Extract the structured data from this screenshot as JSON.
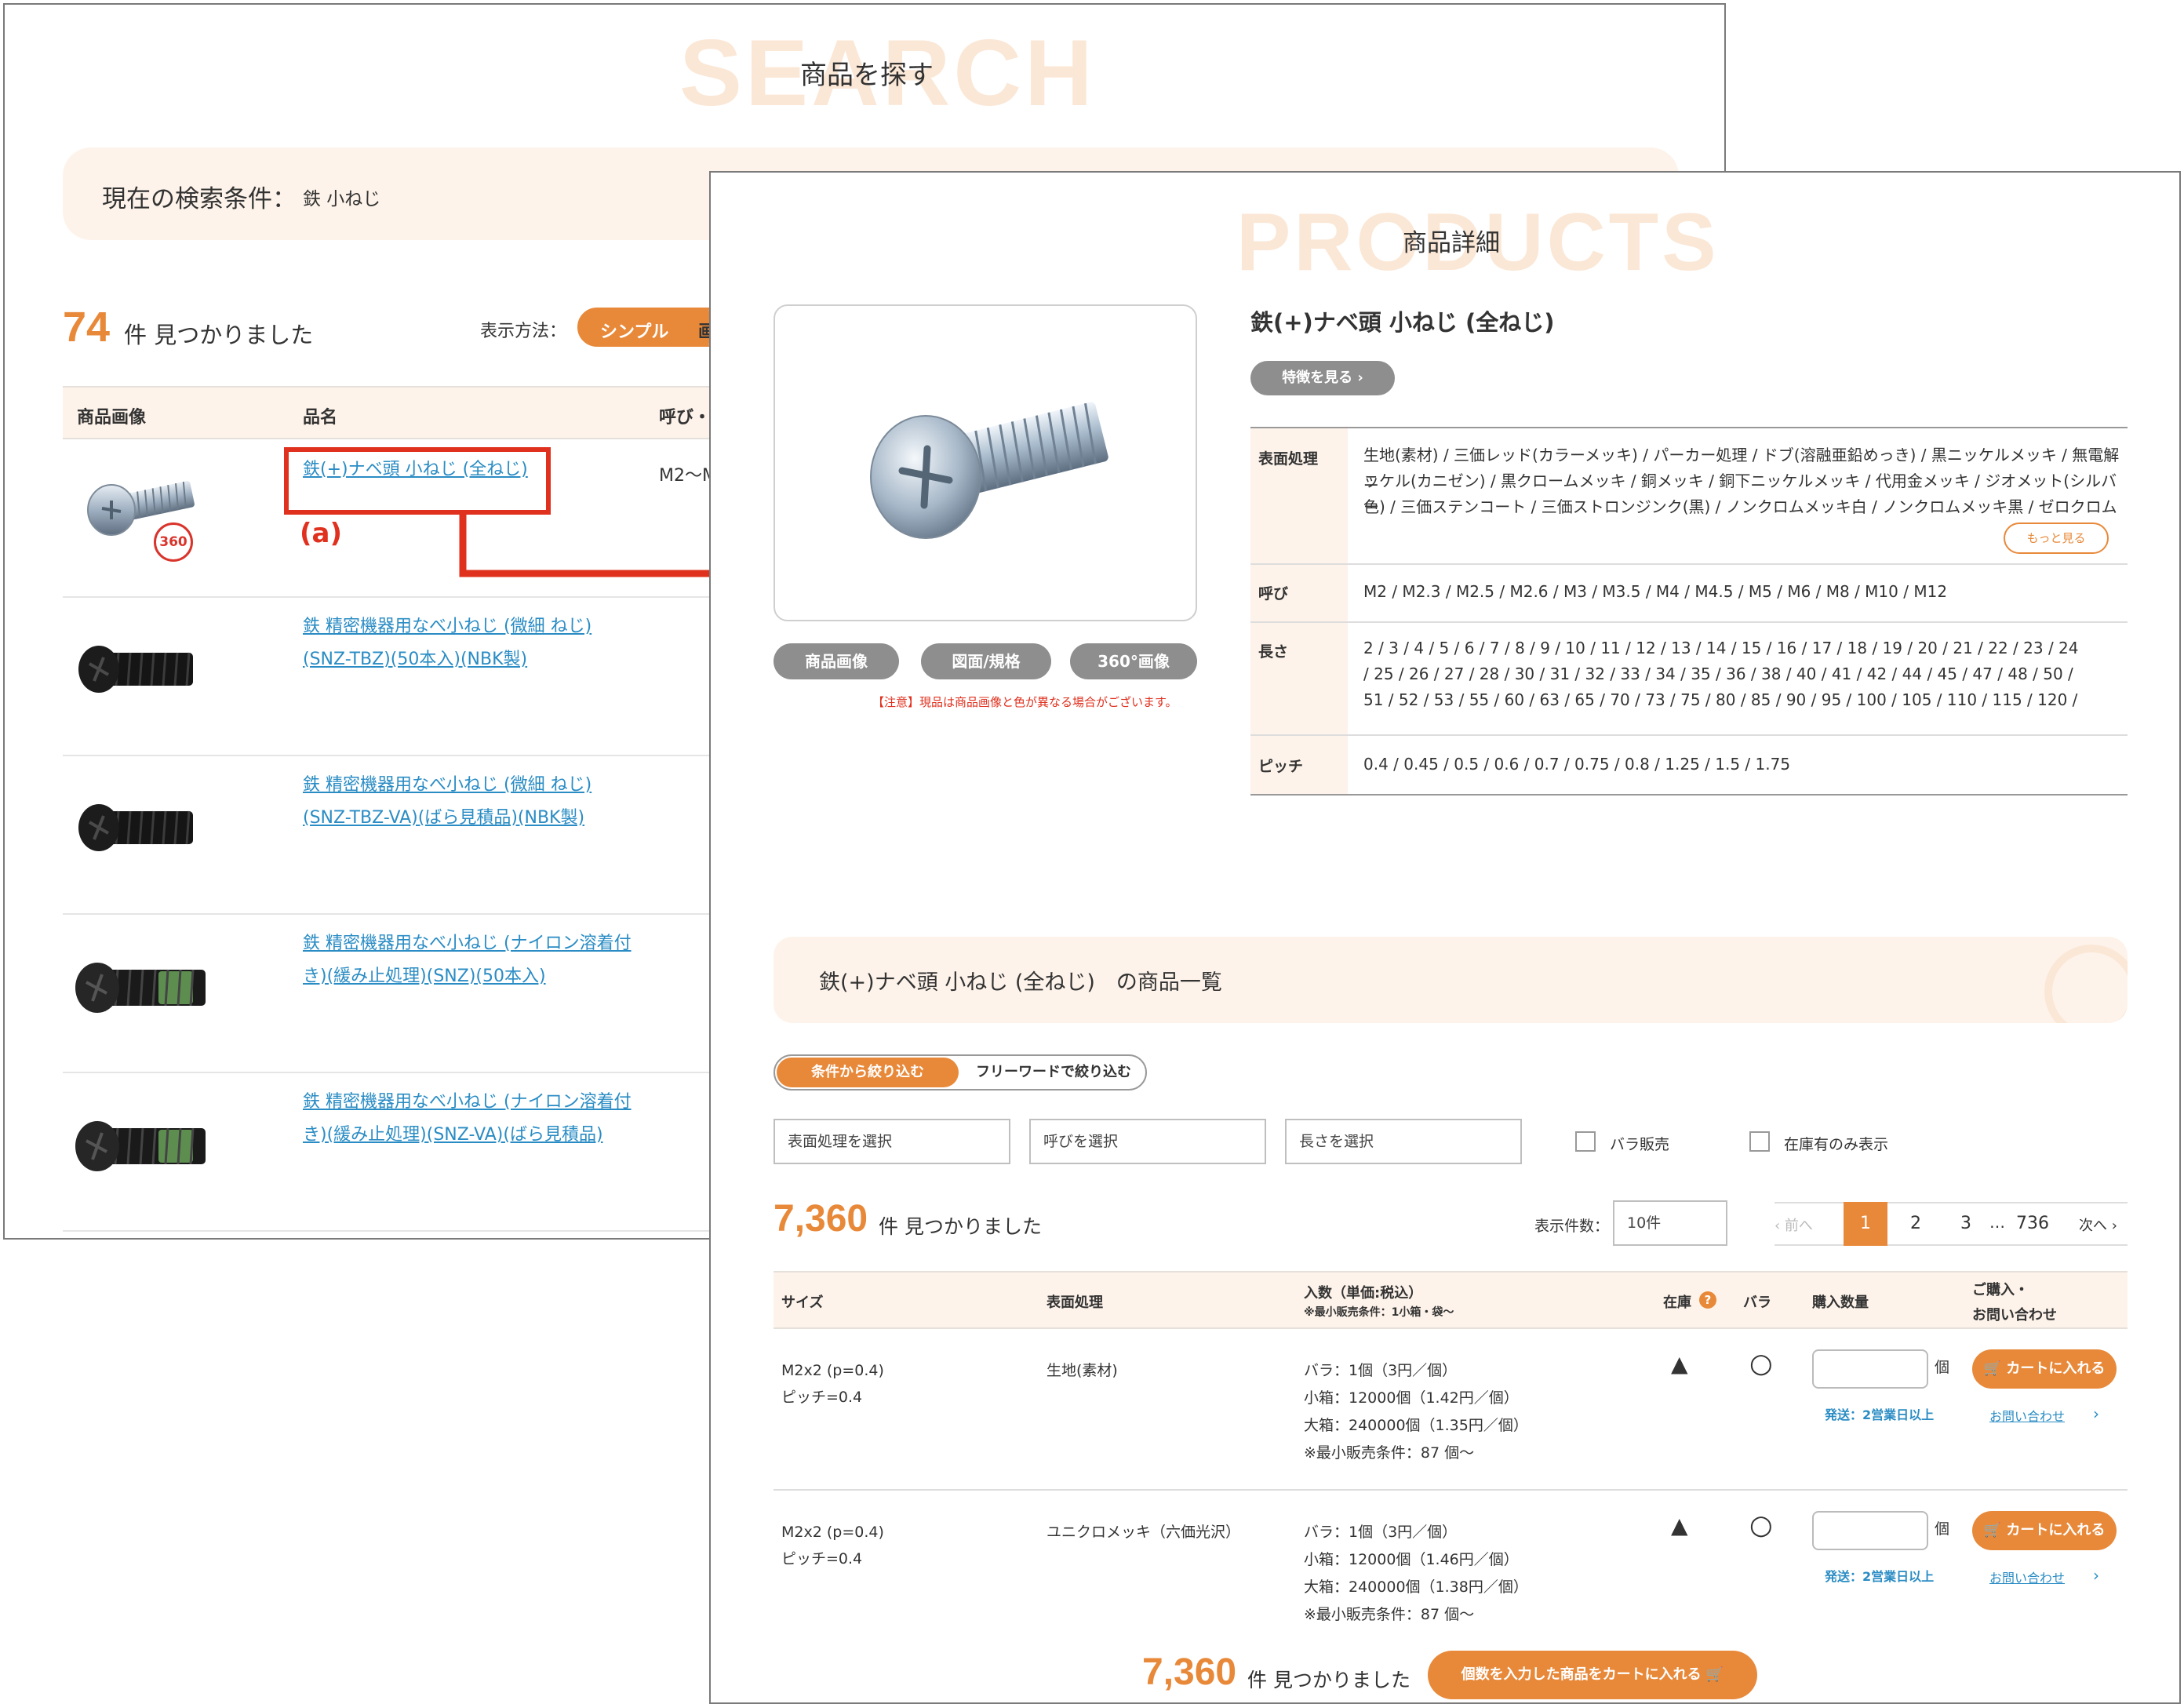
{
  "search_page": {
    "watermark": "SEARCH",
    "title": "商品を探す",
    "condition_label": "現在の検索条件：",
    "condition_value": "鉄 小ねじ",
    "result_count": "74",
    "result_suffix": "件 見つかりました",
    "display_label": "表示方法：",
    "display_simple": "シンプル",
    "display_image": "画",
    "columns": [
      "商品画像",
      "品名",
      "呼び・"
    ],
    "rows": [
      {
        "name_line1": "鉄(+)ナベ頭 小ねじ (全ねじ)",
        "name_line2": "",
        "size": "M2〜M",
        "badge": "360"
      },
      {
        "name_line1": "鉄 精密機器用なべ小ねじ (微細 ねじ)",
        "name_line2": "(SNZ-TBZ)(50本入)(NBK製)",
        "size": ""
      },
      {
        "name_line1": "鉄 精密機器用なべ小ねじ (微細 ねじ)",
        "name_line2": "(SNZ-TBZ-VA)(ばら見積品)(NBK製)",
        "size": ""
      },
      {
        "name_line1": "鉄 精密機器用なべ小ねじ (ナイロン溶着付",
        "name_line2": "き)(緩み止処理)(SNZ)(50本入)",
        "size": ""
      },
      {
        "name_line1": "鉄 精密機器用なべ小ねじ (ナイロン溶着付",
        "name_line2": "き)(緩み止処理)(SNZ-VA)(ばら見積品)",
        "size": ""
      }
    ],
    "annotation": "(a)"
  },
  "detail_page": {
    "watermark": "PRODUCTS",
    "title": "商品詳細",
    "product_name": "鉄(+)ナベ頭 小ねじ (全ねじ)",
    "feature_button": "特徴を見る",
    "image_tabs": [
      "商品画像",
      "図面/規格",
      "360°画像"
    ],
    "notice": "【注意】現品は商品画像と色が異なる場合がございます。",
    "specs": [
      {
        "label": "表面処理",
        "lines": [
          "生地(素材) / 三価レッド(カラーメッキ) / パーカー処理 / ドブ(溶融亜鉛めっき) / 黒ニッケルメッキ / 無電解ニ",
          "ッケル(カニゼン) / 黒クロームメッキ / 銅メッキ / 銅下ニッケルメッキ / 代用金メッキ / ジオメット(シルバー",
          "色) / 三価ステンコート / 三価ストロンジンク(黒) / ノンクロムメッキ白 / ノンクロムメッキ黒 / ゼロクロム"
        ],
        "more": "もっと見る"
      },
      {
        "label": "呼び",
        "lines": [
          "M2 / M2.3 / M2.5 / M2.6 / M3 / M3.5 / M4 / M4.5 / M5 / M6 / M8 / M10 / M12"
        ]
      },
      {
        "label": "長さ",
        "lines": [
          "2 / 3 / 4 / 5 / 6 / 7 / 8 / 9 / 10 / 11 / 12 / 13 / 14 / 15 / 16 / 17 / 18 / 19 / 20 / 21 / 22 / 23 / 24",
          "/ 25 / 26 / 27 / 28 / 30 / 31 / 32 / 33 / 34 / 35 / 36 / 38 / 40 / 41 / 42 / 44 / 45 / 47 / 48 / 50 /",
          "51 / 52 / 53 / 55 / 60 / 63 / 65 / 70 / 73 / 75 / 80 / 85 / 90 / 95 / 100 / 105 / 110 / 115 / 120 /"
        ]
      },
      {
        "label": "ピッチ",
        "lines": [
          "0.4 / 0.45 / 0.5 / 0.6 / 0.7 / 0.75 / 0.8 / 1.25 / 1.5 / 1.75"
        ]
      }
    ],
    "list_title": "鉄(+)ナベ頭 小ねじ (全ねじ)　の商品一覧",
    "filter_tabs": [
      "条件から絞り込む",
      "フリーワードで絞り込む"
    ],
    "filters": [
      "表面処理を選択",
      "呼びを選択",
      "長さを選択"
    ],
    "checks": [
      "バラ販売",
      "在庫有のみ表示"
    ],
    "count": "7,360",
    "count_suffix": "件 見つかりました",
    "per_page_label": "表示件数：",
    "per_page_value": "10件",
    "pagination": {
      "prev": "前へ",
      "pages": [
        "1",
        "2",
        "3"
      ],
      "ellipsis": "…",
      "last": "736",
      "next": "次へ"
    },
    "table_headers": {
      "size": "サイズ",
      "surface": "表面処理",
      "qty": "入数（単価:税込）",
      "qty_note": "※最小販売条件：1小箱・袋〜",
      "stock": "在庫",
      "bara": "バラ",
      "purchase": "購入数量",
      "buy_line1": "ご購入・",
      "buy_line2": "お問い合わせ"
    },
    "rows": [
      {
        "size": "M2x2 (p=0.4)",
        "pitch": "ピッチ=0.4",
        "surface": "生地(素材)",
        "q1": "バラ：1個（3円／個）",
        "q2": "小箱：12000個（1.42円／個）",
        "q3": "大箱：240000個（1.35円／個）",
        "q4": "※最小販売条件：87 個〜",
        "stock": "▲",
        "bara": "○",
        "unit": "個",
        "ship": "発送：2営業日以上",
        "cart": "カートに入れる",
        "inquiry": "お問い合わせ"
      },
      {
        "size": "M2x2 (p=0.4)",
        "pitch": "ピッチ=0.4",
        "surface": "ユニクロメッキ（六価光沢）",
        "q1": "バラ：1個（3円／個）",
        "q2": "小箱：12000個（1.46円／個）",
        "q3": "大箱：240000個（1.38円／個）",
        "q4": "※最小販売条件：87 個〜",
        "stock": "▲",
        "bara": "○",
        "unit": "個",
        "ship": "発送：2営業日以上",
        "cart": "カートに入れる",
        "inquiry": "お問い合わせ"
      }
    ],
    "footer_count": "7,360",
    "footer_suffix": "件 見つかりました",
    "bulk_cart": "個数を入力した商品をカートに入れる"
  },
  "colors": {
    "accent": "#e8893a",
    "annotation_red": "#e0301e",
    "link": "#2a8cc4",
    "cream": "#fdf3ea"
  }
}
